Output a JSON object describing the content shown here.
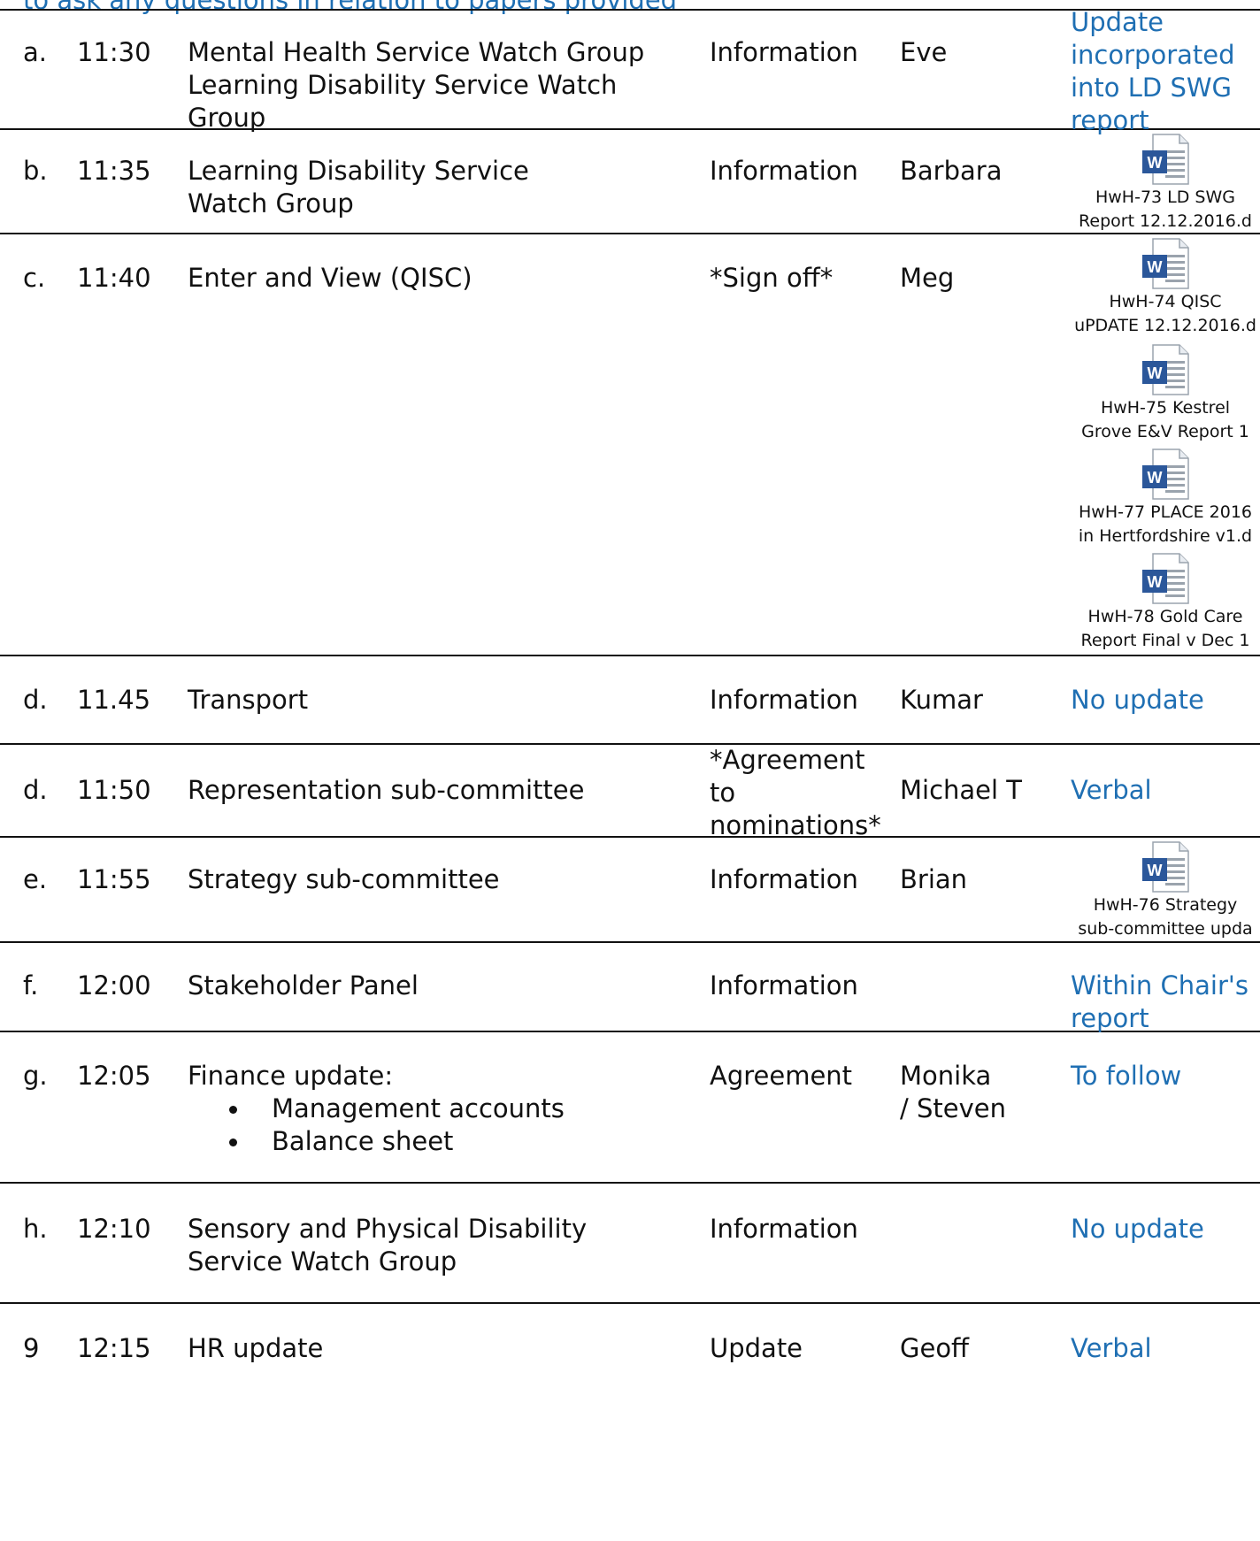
{
  "top_note": "to ask any questions in relation to papers provided",
  "rows": [
    {
      "letter": "a.",
      "time": "11:30",
      "item": [
        "Mental Health Service Watch Group",
        "Learning Disability Service Watch Group"
      ],
      "purpose": "Information",
      "lead": "Eve",
      "papers": "Update incorporated into LD SWG report"
    },
    {
      "letter": "b.",
      "time": "11:35",
      "item": "Learning Disability Service Watch Group",
      "purpose": "Information",
      "lead": "Barbara",
      "attachments": [
        {
          "caption_1": "HwH-73 LD SWG",
          "caption_2": "Report 12.12.2016.d",
          "icon": "word-document-icon"
        }
      ]
    },
    {
      "letter": "c.",
      "time": "11:40",
      "item": "Enter and View (QISC)",
      "purpose": "*Sign off*",
      "lead": "Meg",
      "attachments": [
        {
          "caption_1": "HwH-74 QISC",
          "caption_2": "uPDATE 12.12.2016.d",
          "icon": "word-document-icon"
        },
        {
          "caption_1": "HwH-75 Kestrel",
          "caption_2": "Grove E&V Report 1",
          "icon": "word-document-icon"
        },
        {
          "caption_1": "HwH-77 PLACE 2016",
          "caption_2": "in Hertfordshire v1.d",
          "icon": "word-document-icon"
        },
        {
          "caption_1": "HwH-78 Gold Care",
          "caption_2": "Report Final v Dec 1",
          "icon": "word-document-icon"
        }
      ]
    },
    {
      "letter": "d.",
      "time": "11.45",
      "item": "Transport",
      "purpose": "Information",
      "lead": "Kumar",
      "papers": "No update"
    },
    {
      "letter": "d.",
      "time": "11:50",
      "item": "Representation sub-committee",
      "purpose": "*Agreement to nominations*",
      "lead": "Michael T",
      "papers": "Verbal"
    },
    {
      "letter": "e.",
      "time": "11:55",
      "item": "Strategy sub-committee",
      "purpose": "Information",
      "lead": "Brian",
      "attachments": [
        {
          "caption_1": "HwH-76 Strategy",
          "caption_2": "sub-committee upda",
          "icon": "word-document-icon"
        }
      ]
    },
    {
      "letter": "f.",
      "time": "12:00",
      "item": "Stakeholder Panel",
      "purpose": "Information",
      "lead": "",
      "papers": "Within Chair's report"
    },
    {
      "letter": "g.",
      "time": "12:05",
      "item": "Finance update:",
      "bullets": [
        "Management accounts",
        "Balance sheet"
      ],
      "purpose": "Agreement",
      "lead": "Monika / Steven",
      "papers": "To follow"
    },
    {
      "letter": "h.",
      "time": "12:10",
      "item": "Sensory and Physical Disability Service Watch Group",
      "purpose": "Information",
      "lead": "",
      "papers": "No update"
    },
    {
      "letter": "9",
      "time": "12:15",
      "item": "HR update",
      "purpose": "Update",
      "lead": "Geoff",
      "papers": "Verbal"
    }
  ],
  "colors": {
    "link_blue": "#1f6fb3",
    "rule": "#111111",
    "word_blue": "#2b579a"
  }
}
